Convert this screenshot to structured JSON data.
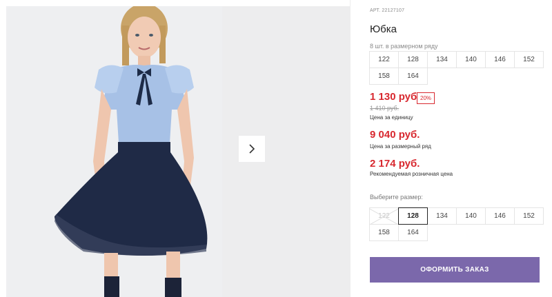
{
  "gallery": {
    "next_icon": "chevron-right-icon"
  },
  "product": {
    "article": "АРТ. 22127107",
    "title": "Юбка",
    "set_label": "8 шт. в размерном ряду",
    "set_sizes": [
      "122",
      "128",
      "134",
      "140",
      "146",
      "152",
      "158",
      "164"
    ]
  },
  "pricing": {
    "unit_price": "1 130 руб.",
    "discount": "20%",
    "old_price": "1 410 руб.",
    "unit_label": "Цена за единицу",
    "set_price": "9 040 руб.",
    "set_label": "Цена за размерный ряд",
    "retail_price": "2 174 руб.",
    "retail_label": "Рекомендуемая розничная цена",
    "accent_color": "#d8282f"
  },
  "size_select": {
    "label": "Выберите размер:",
    "options": [
      {
        "label": "122",
        "state": "disabled"
      },
      {
        "label": "128",
        "state": "selected"
      },
      {
        "label": "134",
        "state": "available"
      },
      {
        "label": "140",
        "state": "available"
      },
      {
        "label": "146",
        "state": "available"
      },
      {
        "label": "152",
        "state": "available"
      },
      {
        "label": "158",
        "state": "available"
      },
      {
        "label": "164",
        "state": "available"
      }
    ]
  },
  "order": {
    "button_label": "ОФОРМИТЬ ЗАКАЗ",
    "button_color": "#7b68ab"
  }
}
